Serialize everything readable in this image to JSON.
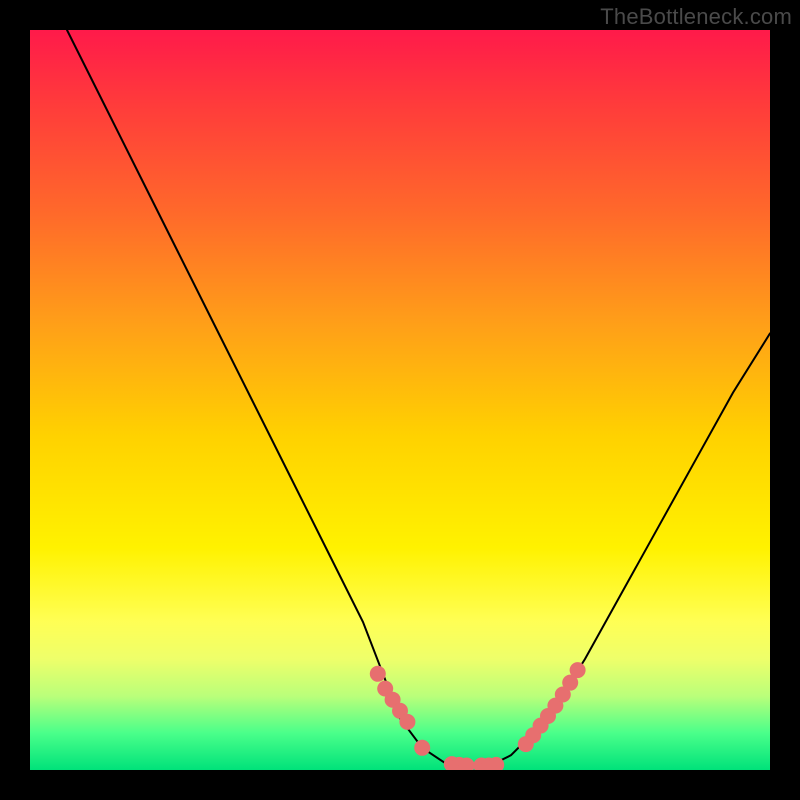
{
  "watermark": "TheBottleneck.com",
  "chart_data": {
    "type": "line",
    "title": "",
    "xlabel": "",
    "ylabel": "",
    "xlim": [
      0,
      100
    ],
    "ylim": [
      0,
      100
    ],
    "series": [
      {
        "name": "bottleneck-curve",
        "x": [
          5,
          10,
          15,
          20,
          25,
          30,
          35,
          40,
          45,
          50,
          53,
          56,
          59,
          62,
          65,
          70,
          75,
          80,
          85,
          90,
          95,
          100
        ],
        "y": [
          100,
          90,
          80,
          70,
          60,
          50,
          40,
          30,
          20,
          7,
          3,
          1,
          0.5,
          0.5,
          2,
          7,
          15,
          24,
          33,
          42,
          51,
          59
        ]
      }
    ],
    "markers": {
      "name": "highlight-dots",
      "color": "#e76f6f",
      "x": [
        47,
        48,
        49,
        50,
        51,
        53,
        57,
        58,
        59,
        61,
        62,
        63,
        67,
        68,
        69,
        70,
        71,
        72,
        73,
        74
      ],
      "y": [
        13,
        11,
        9.5,
        8,
        6.5,
        3,
        0.8,
        0.7,
        0.6,
        0.6,
        0.6,
        0.7,
        3.5,
        4.7,
        6,
        7.3,
        8.7,
        10.2,
        11.8,
        13.5
      ]
    }
  }
}
